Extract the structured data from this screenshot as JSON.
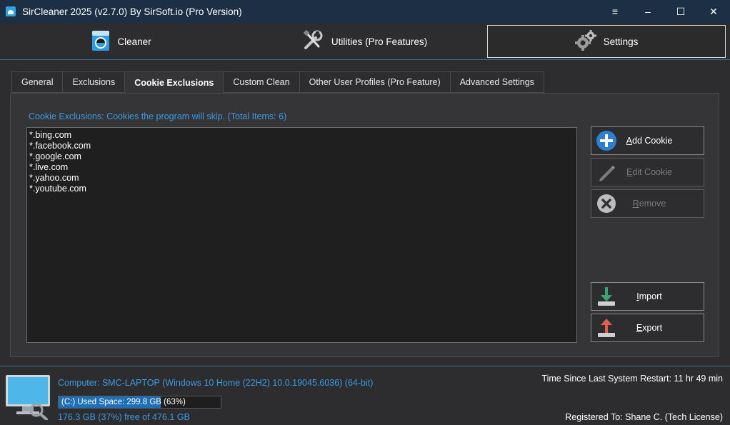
{
  "window": {
    "title": "SirCleaner 2025 (v2.7.0) By SirSoft.io (Pro Version)",
    "menu_glyph": "≡",
    "minimize_glyph": "–",
    "maximize_glyph": "☐",
    "close_glyph": "✕"
  },
  "main_tabs": [
    {
      "label": "Cleaner",
      "icon": "washing-machine-icon"
    },
    {
      "label": "Utilities (Pro Features)",
      "icon": "wrench-screwdriver-icon"
    },
    {
      "label": "Settings",
      "icon": "gears-icon",
      "active": true
    }
  ],
  "sub_tabs": [
    {
      "label": "General"
    },
    {
      "label": "Exclusions"
    },
    {
      "label": "Cookie Exclusions",
      "active": true
    },
    {
      "label": "Custom Clean"
    },
    {
      "label": "Other User Profiles (Pro Feature)"
    },
    {
      "label": "Advanced Settings"
    }
  ],
  "cookie_exclusions": {
    "caption": "Cookie Exclusions: Cookies the program will skip. (Total Items: 6)",
    "items": [
      "*.bing.com",
      "*.facebook.com",
      "*.google.com",
      "*.live.com",
      "*.yahoo.com",
      "*.youtube.com"
    ]
  },
  "buttons": {
    "add": {
      "mnemonic": "A",
      "rest": "dd Cookie"
    },
    "edit": {
      "mnemonic": "E",
      "rest": "dit Cookie"
    },
    "remove": {
      "mnemonic": "R",
      "rest": "emove"
    },
    "import": {
      "mnemonic": "I",
      "rest": "mport"
    },
    "export": {
      "mnemonic": "E",
      "rest": "xport"
    }
  },
  "footer": {
    "computer": "Computer: SMC-LAPTOP (Windows 10 Home (22H2) 10.0.19045.6036) (64-bit)",
    "disk_used_text": "(C:) Used Space: 299.8 GB (63%)",
    "disk_used_fraction": 0.63,
    "disk_free_text": "176.3 GB (37%) free of 476.1 GB",
    "restart": "Time Since Last System Restart: 11 hr 49 min",
    "registered": "Registered To: Shane C. (Tech License)"
  },
  "colors": {
    "accent_blue": "#3b9ae1",
    "titlebar": "#1c2f44",
    "background": "#2d2d30"
  }
}
